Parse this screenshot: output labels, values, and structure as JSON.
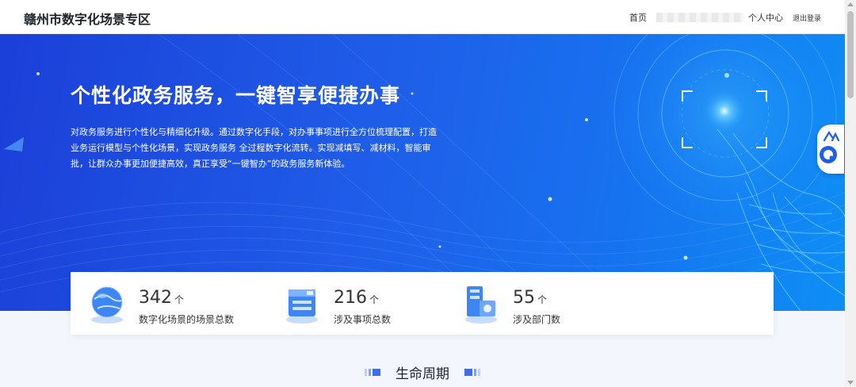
{
  "header": {
    "site_title": "赣州市数字化场景专区",
    "nav_home": "首页",
    "nav_user_center": "个人中心",
    "nav_logout": "退出登录"
  },
  "hero": {
    "title": "个性化政务服务，一键智享便捷办事",
    "description": "对政务服务进行个性化与精细化升级。通过数字化手段，对办事事项进行全方位梳理配置，打造业务运行模型与个性化场景，实现政务服务 全过程数字化流转。实现减填写、减材料，智能审批，让群众办事更加便捷高效，真正享受“一键智办”的政务服务新体验。"
  },
  "stats": [
    {
      "value": "342",
      "unit": "个",
      "label": "数字化场景的场景总数",
      "icon": "globe-icon"
    },
    {
      "value": "216",
      "unit": "个",
      "label": "涉及事项总数",
      "icon": "server-icon"
    },
    {
      "value": "55",
      "unit": "个",
      "label": "涉及部门数",
      "icon": "building-icon"
    }
  ],
  "section": {
    "title": "生命周期"
  },
  "colors": {
    "hero_start": "#1b3fd9",
    "hero_end": "#0e8ff5",
    "accent": "#3b6df0"
  }
}
